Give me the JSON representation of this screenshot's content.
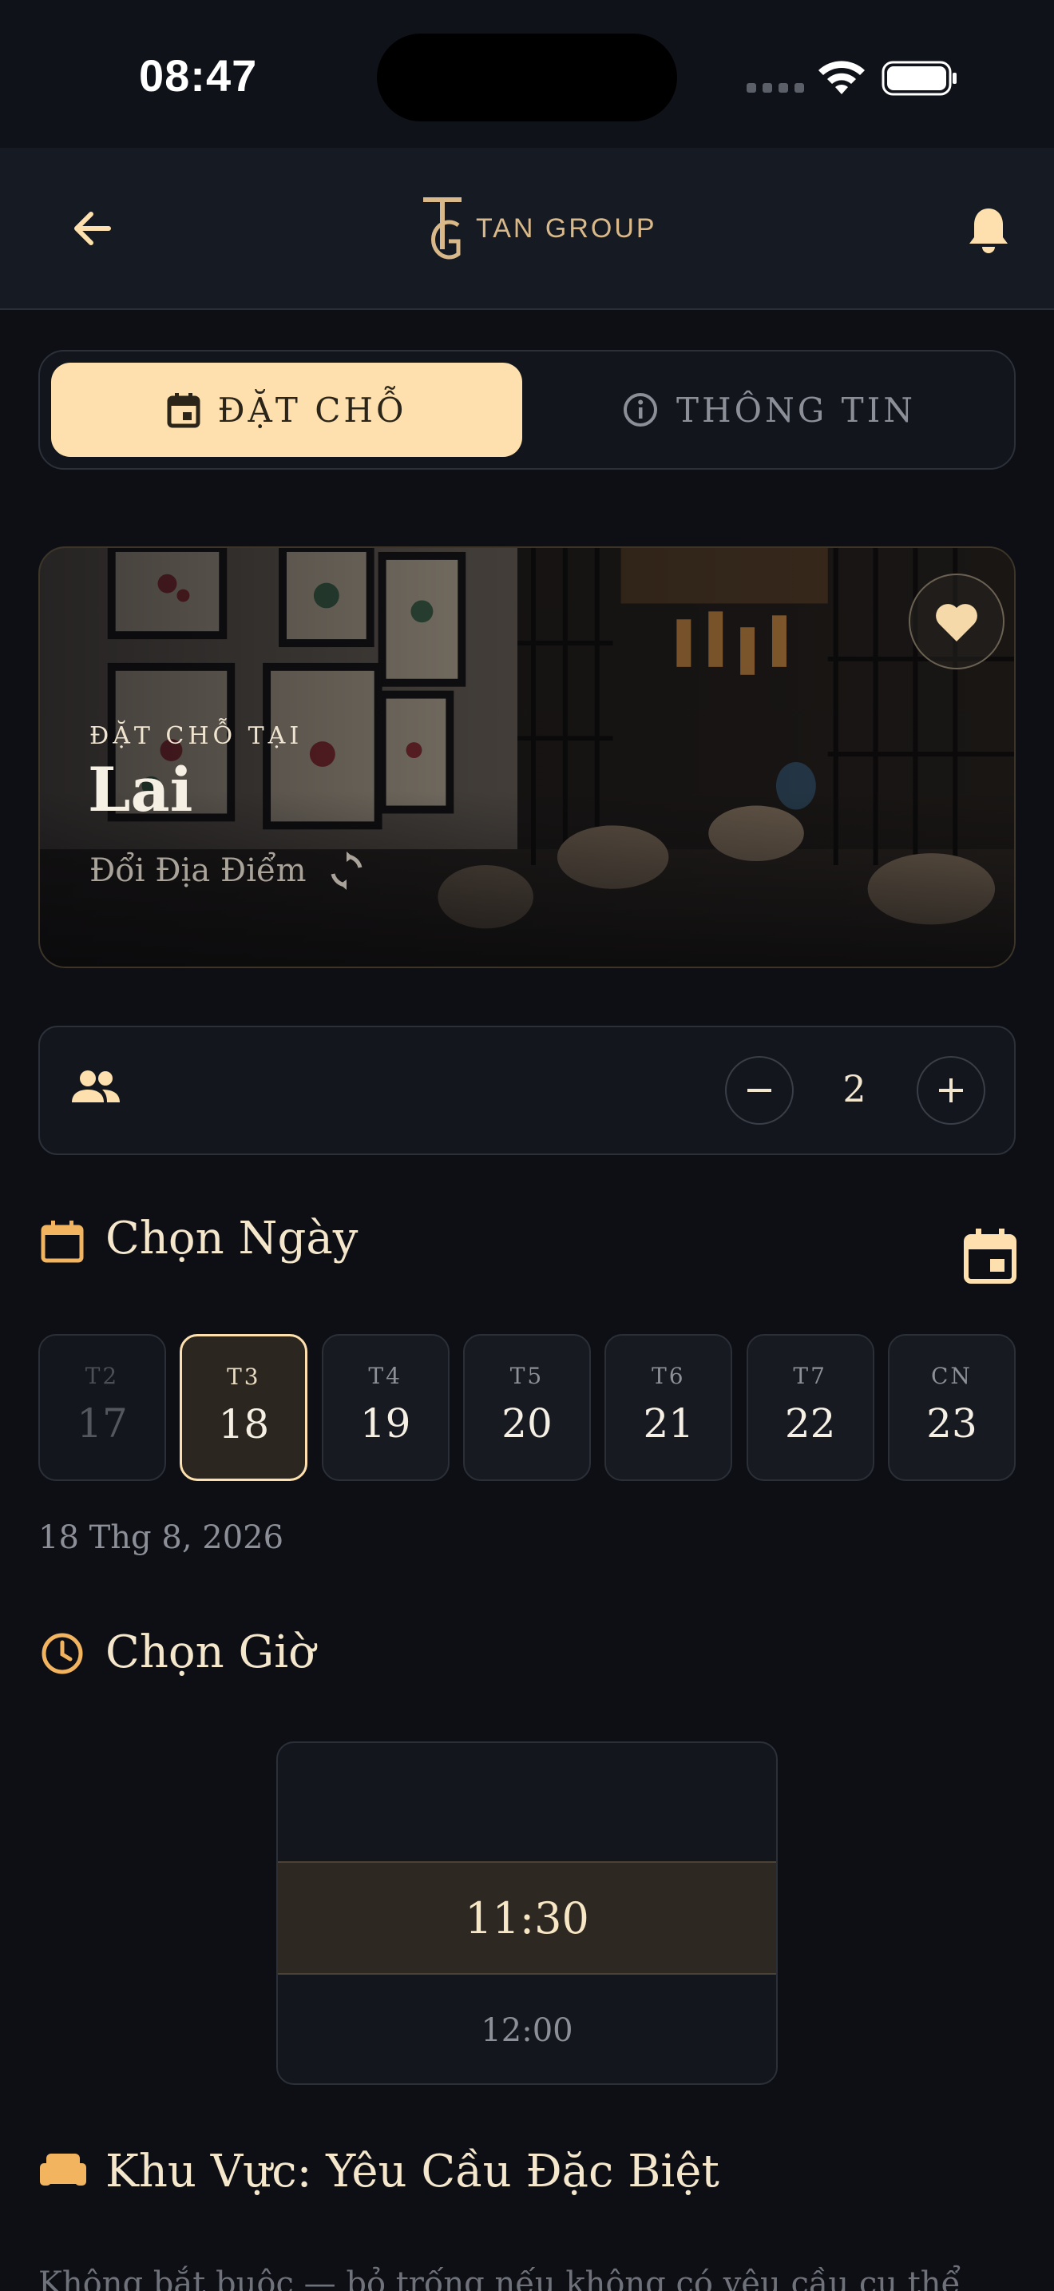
{
  "status_bar": {
    "time": "08:47"
  },
  "header": {
    "brand": "TAN GROUP"
  },
  "tabs": [
    {
      "label": "ĐẶT CHỖ",
      "active": true,
      "icon": "calendar-icon"
    },
    {
      "label": "THÔNG TIN",
      "active": false,
      "icon": "info-icon"
    }
  ],
  "venue": {
    "eyebrow": "ĐẶT CHỖ TẠI",
    "name": "Lai",
    "change_label": "Đổi Địa Điểm"
  },
  "guests": {
    "count": "2"
  },
  "date_section": {
    "title": "Chọn Ngày",
    "days": [
      {
        "dow": "T2",
        "num": "17",
        "state": "past"
      },
      {
        "dow": "T3",
        "num": "18",
        "state": "selected"
      },
      {
        "dow": "T4",
        "num": "19",
        "state": "normal"
      },
      {
        "dow": "T5",
        "num": "20",
        "state": "normal"
      },
      {
        "dow": "T6",
        "num": "21",
        "state": "normal"
      },
      {
        "dow": "T7",
        "num": "22",
        "state": "normal"
      },
      {
        "dow": "CN",
        "num": "23",
        "state": "normal"
      }
    ],
    "selected_caption": "18 Thg 8, 2026"
  },
  "time_section": {
    "title": "Chọn Giờ",
    "selected": "11:30",
    "next": "12:00"
  },
  "area_section": {
    "title": "Khu Vực: Yêu Cầu Đặc Biệt",
    "note": "Không bắt buộc — bỏ trống nếu không có yêu cầu cụ thể"
  },
  "colors": {
    "accent": "#fde0ad",
    "icon_accent": "#f3b45f",
    "background": "#0d0f15"
  }
}
